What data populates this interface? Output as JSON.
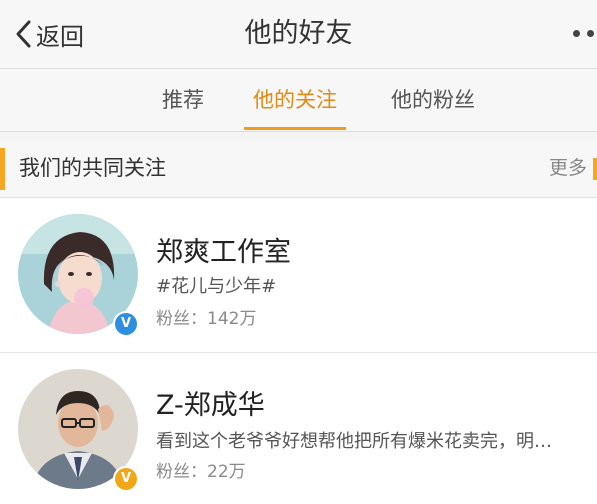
{
  "nav": {
    "back_label": "返回",
    "title": "他的好友",
    "back_icon": "chevron-left-icon",
    "more_icon": "more-dots-icon"
  },
  "tabs": [
    {
      "label": "推荐",
      "active": false
    },
    {
      "label": "他的关注",
      "active": true
    },
    {
      "label": "他的粉丝",
      "active": false
    }
  ],
  "section": {
    "title": "我们的共同关注",
    "more_label": "更多"
  },
  "users": [
    {
      "name": "郑爽工作室",
      "description": "#花儿与少年#",
      "fans": "粉丝：142万",
      "verified_color": "#2f8ee0",
      "verified_mark": "V"
    },
    {
      "name": "Z-郑成华",
      "description": "看到这个老爷爷好想帮他把所有爆米花卖完，明…",
      "fans": "粉丝：22万",
      "verified_color": "#f0a818",
      "verified_mark": "V"
    }
  ],
  "colors": {
    "accent": "#e38a15",
    "section_marker": "#f5a623",
    "background": "#f4f4f4"
  }
}
